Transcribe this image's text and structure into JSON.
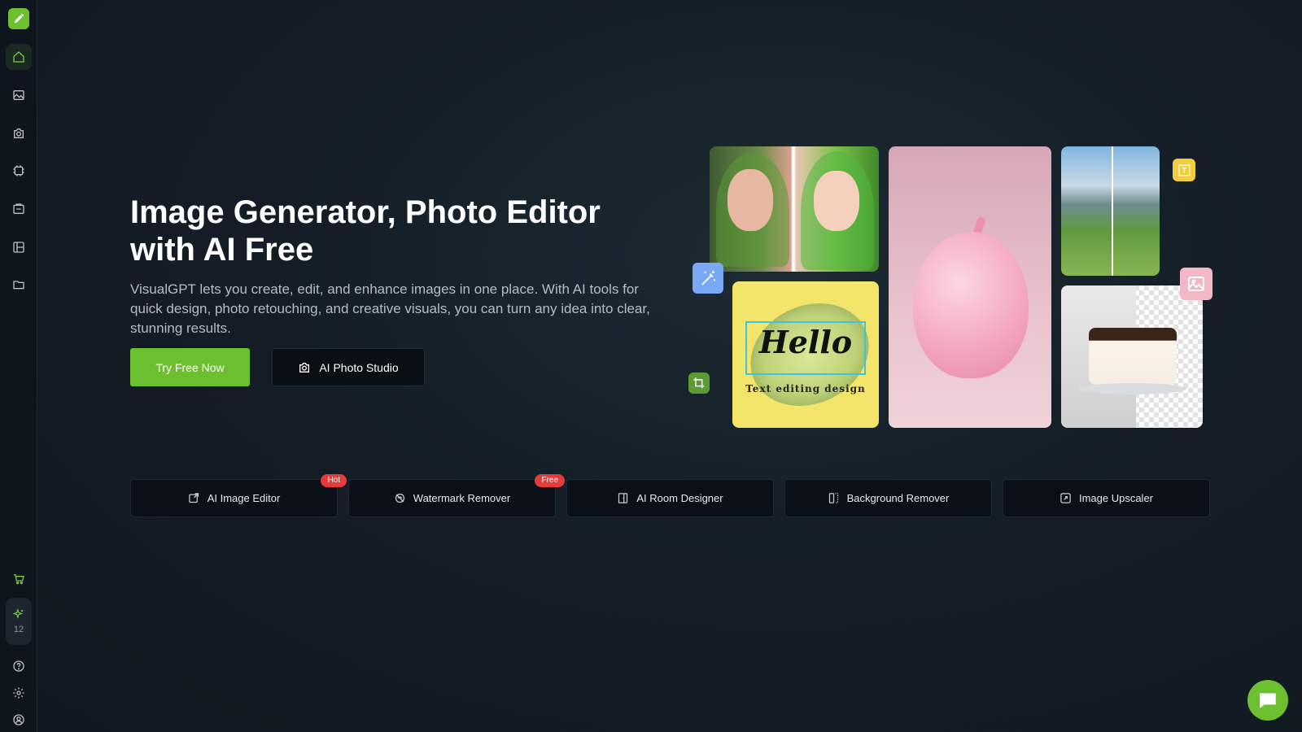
{
  "sidebar": {
    "credits": "12",
    "items": [
      {
        "icon": "home-icon"
      },
      {
        "icon": "image-icon"
      },
      {
        "icon": "camera-icon"
      },
      {
        "icon": "ai-chip-icon"
      },
      {
        "icon": "gallery-icon"
      },
      {
        "icon": "layout-icon"
      },
      {
        "icon": "folder-icon"
      }
    ],
    "bottom": [
      {
        "icon": "cart-icon"
      },
      {
        "icon": "sparkle-icon"
      },
      {
        "icon": "help-icon"
      },
      {
        "icon": "settings-icon"
      },
      {
        "icon": "account-icon"
      }
    ]
  },
  "hero": {
    "title": "Image Generator, Photo Editor with AI Free",
    "description": "VisualGPT lets you create, edit, and enhance images in one place. With AI tools for quick design, photo retouching, and creative visuals, you can turn any idea into clear, stunning results.",
    "primary_button": "Try Free Now",
    "secondary_button": "AI Photo Studio"
  },
  "collage": {
    "hello_text": "Hello",
    "hello_subtitle": "Text editing design"
  },
  "tools": [
    {
      "label": "AI Image Editor",
      "badge": "Hot",
      "icon": "edit-image-icon"
    },
    {
      "label": "Watermark Remover",
      "badge": "Free",
      "icon": "watermark-icon"
    },
    {
      "label": "AI Room Designer",
      "badge": "",
      "icon": "room-icon"
    },
    {
      "label": "Background Remover",
      "badge": "",
      "icon": "bg-remove-icon"
    },
    {
      "label": "Image Upscaler",
      "badge": "",
      "icon": "upscale-icon"
    }
  ],
  "colors": {
    "accent": "#6cbf2e",
    "badge": "#e53b3b",
    "background": "#141d26"
  }
}
